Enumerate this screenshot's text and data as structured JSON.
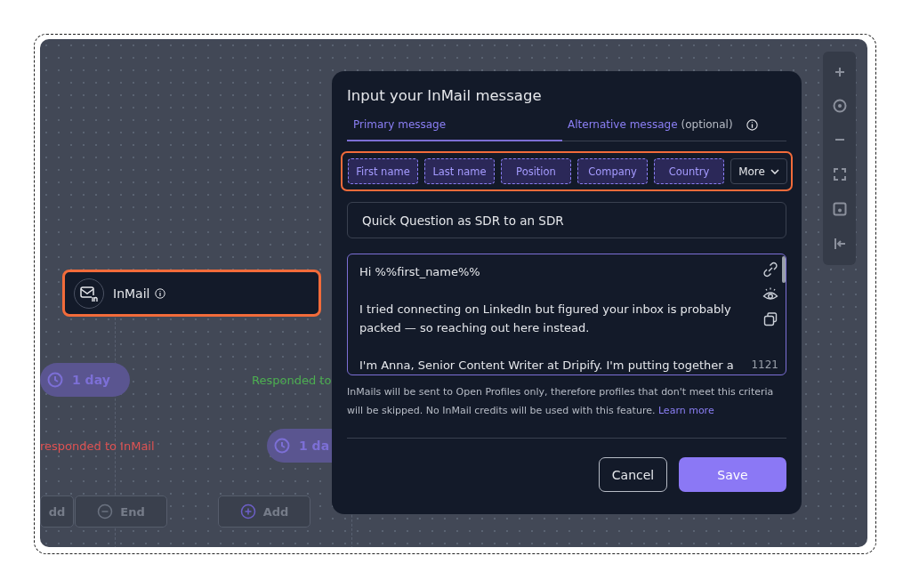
{
  "canvas": {
    "node": {
      "title": "InMail"
    },
    "pills": [
      {
        "label": "1 day"
      },
      {
        "label": "1 da"
      }
    ],
    "branch_labels": [
      {
        "kind": "positive",
        "label": "Responded to"
      },
      {
        "kind": "negative",
        "label": "responded to InMail"
      }
    ],
    "actions": [
      {
        "kind": "add",
        "label": "dd"
      },
      {
        "kind": "end",
        "label": "End"
      },
      {
        "kind": "add",
        "label": "Add"
      }
    ]
  },
  "dialog": {
    "title": "Input your InMail message",
    "tabs": [
      {
        "label": "Primary message",
        "selected": true
      },
      {
        "label": "Alternative message",
        "note": "(optional)",
        "selected": false
      }
    ],
    "variables": [
      "First name",
      "Last name",
      "Position",
      "Company",
      "Country"
    ],
    "more": "More",
    "subject": "Quick Question as SDR to an SDR",
    "message": [
      "Hi %%first_name%%",
      "I tried connecting on LinkedIn but figured your inbox is probably packed — so reaching out here instead.",
      "I'm Anna, Senior Content Writer at Dripify. I'm putting together a"
    ],
    "char_count": "1121",
    "note": "InMails will be sent to Open Profiles only, therefore profiles that don't meet this criteria will be skipped. No InMail credits will be used with this feature.",
    "learn_more": "Learn more",
    "buttons": [
      {
        "kind": "secondary",
        "label": "Cancel"
      },
      {
        "kind": "primary",
        "label": "Save"
      }
    ]
  }
}
